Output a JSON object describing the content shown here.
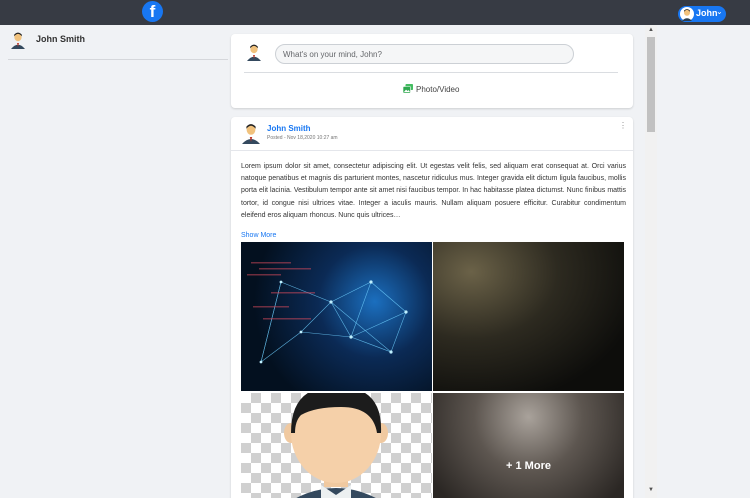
{
  "header": {
    "logo_letter": "f",
    "user_chip_name": "John",
    "caret": "⌄"
  },
  "sidebar": {
    "user_name": "John Smith"
  },
  "composer": {
    "placeholder": "What's on your mind, John?",
    "photo_label": "Photo/Video"
  },
  "post": {
    "author": "John Smith",
    "posted": "Posted - Nov 18,2020 10:27 am",
    "kebab": "⋮",
    "body": "Lorem ipsum dolor sit amet, consectetur adipiscing elit. Ut egestas velit felis, sed aliquam erat consequat at. Orci varius natoque penatibus et magnis dis parturient montes, nascetur ridiculus mus. Integer gravida elit dictum ligula faucibus, mollis porta elit lacinia. Vestibulum tempor ante sit amet nisi faucibus tempor. In hac habitasse platea dictumst. Nunc finibus mattis tortor, id congue nisi ultrices vitae. Integer a iaculis mauris. Nullam aliquam posuere efficitur. Curabitur condimentum eleifend eros aliquam rhoncus. Nunc quis ultrices…",
    "show_more": "Show More",
    "more_images_label": "+ 1 More"
  },
  "colors": {
    "brand": "#1877f2",
    "topbar": "#373b44"
  }
}
